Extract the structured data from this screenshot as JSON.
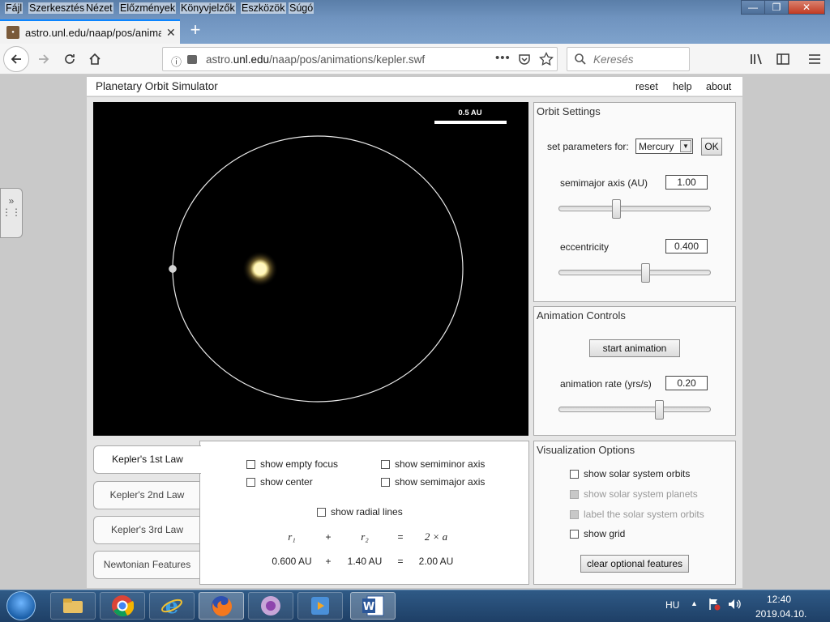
{
  "browser": {
    "menu": [
      "Fájl",
      "Szerkesztés",
      "Nézet",
      "Előzmények",
      "Könyvjelzők",
      "Eszközök",
      "Súgó"
    ],
    "tab_title": "astro.unl.edu/naap/pos/animat",
    "url_prefix": "astro.",
    "url_domain": "unl.edu",
    "url_path": "/naap/pos/animations/kepler.swf",
    "search_placeholder": "Keresés",
    "new_tab": "+",
    "tab_close": "✕"
  },
  "sim": {
    "title": "Planetary Orbit Simulator",
    "links": [
      "reset",
      "help",
      "about"
    ],
    "scale_label": "0.5 AU",
    "orbit_settings": {
      "title": "Orbit Settings",
      "set_params_label": "set parameters for:",
      "planet": "Mercury",
      "ok_label": "OK",
      "semimajor_label": "semimajor axis (AU)",
      "semimajor_value": "1.00",
      "semimajor_slider": 0.38,
      "eccentricity_label": "eccentricity",
      "eccentricity_value": "0.400",
      "eccentricity_slider": 0.57
    },
    "animation": {
      "title": "Animation Controls",
      "start_label": "start animation",
      "rate_label": "animation rate (yrs/s)",
      "rate_value": "0.20",
      "rate_slider": 0.66
    },
    "visualization": {
      "title": "Visualization Options",
      "options": [
        {
          "label": "show solar system orbits",
          "enabled": true
        },
        {
          "label": "show solar system planets",
          "enabled": false
        },
        {
          "label": "label the solar system orbits",
          "enabled": false
        },
        {
          "label": "show grid",
          "enabled": true
        }
      ],
      "clear_label": "clear optional features"
    },
    "tabs": [
      "Kepler's 1st Law",
      "Kepler's 2nd Law",
      "Kepler's 3rd Law",
      "Newtonian Features"
    ],
    "first_law": {
      "options": [
        "show empty focus",
        "show semiminor axis",
        "show center",
        "show semimajor axis",
        "show radial lines"
      ],
      "eq_symbols": [
        "r₁",
        "+",
        "r₂",
        "=",
        "2 × a"
      ],
      "eq_values": [
        "0.600 AU",
        "+",
        "1.40 AU",
        "=",
        "2.00 AU"
      ]
    }
  },
  "taskbar": {
    "lang": "HU",
    "time": "12:40",
    "date": "2019.04.10."
  }
}
